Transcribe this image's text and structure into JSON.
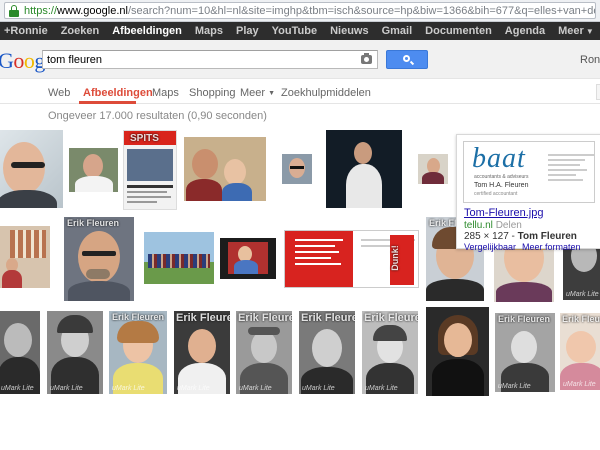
{
  "browser": {
    "url_secure": "https://",
    "url_host": "www.google.nl",
    "url_path": "/search?num=10&hl=nl&site=imghp&tbm=isch&source=hp&biw=1366&bih=677&q=elles+van+der+heijden&oq=elles+v"
  },
  "gbar": {
    "items": [
      "+Ronnie",
      "Zoeken",
      "Afbeeldingen",
      "Maps",
      "Play",
      "YouTube",
      "Nieuws",
      "Gmail",
      "Documenten",
      "Agenda",
      "Meer"
    ],
    "active_index": 2
  },
  "header": {
    "logo": [
      "G",
      "o",
      "o",
      "g",
      "l",
      "e"
    ],
    "query": "tom fleuren",
    "user": "Ronnie"
  },
  "tabs": {
    "items": [
      "Web",
      "Afbeeldingen",
      "Maps",
      "Shopping",
      "Meer",
      "Zoekhulpmiddelen"
    ],
    "active_index": 1
  },
  "results": {
    "stats": "Ongeveer 17.000 resultaten (0,90 seconden)"
  },
  "thumb_text": {
    "spits": "SPITS",
    "erik": "Erik Fleuren",
    "watermark": "uMark Lite",
    "dunk": "Dunk!"
  },
  "panel": {
    "logo": "baat",
    "logo_sub": "accountants & adviseurs",
    "card_name": "Tom H.A. Fleuren",
    "card_role": "certified accountant",
    "title": "Tom-Fleuren.jpg",
    "source": "tellu.nl",
    "share": "Delen",
    "dims": "285 × 127",
    "dims_sep": " - ",
    "dims_name": "Tom Fleuren",
    "link_compare": "Vergelijkbaar",
    "link_more": "Meer formaten"
  }
}
